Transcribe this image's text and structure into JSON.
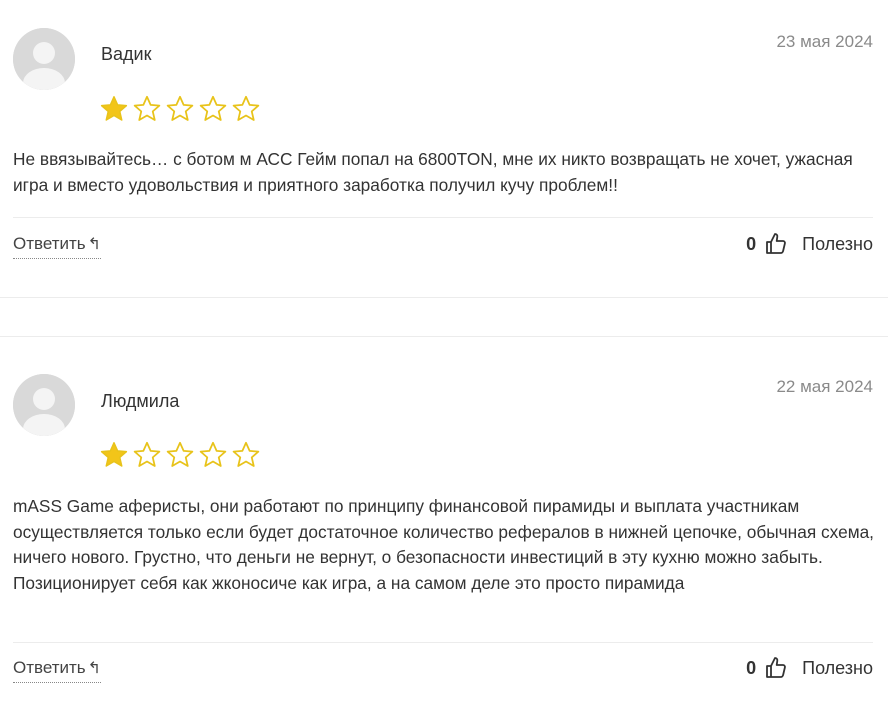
{
  "reviews": [
    {
      "author": "Вадик",
      "date": "23 мая 2024",
      "rating": 1,
      "max_rating": 5,
      "text": "Не ввязывайтесь… с ботом м АСС Гейм попал на 6800TON, мне их никто возвращать не хочет, ужасная игра и вместо удовольствия и приятного заработка получил кучу проблем!!",
      "reply_label": "Ответить",
      "helpful_count": "0",
      "helpful_label": "Полезно"
    },
    {
      "author": "Людмила",
      "date": "22 мая 2024",
      "rating": 1,
      "max_rating": 5,
      "text": "mASS Game аферисты, они работают по принципу финансовой пирамиды и выплата участникам осуществляется только если будет достаточное количество рефералов в нижней цепочке, обычная схема, ничего нового. Грустно, что деньги не вернут, о безопасности инвестиций в эту кухню можно забыть. Позиционирует себя как жконосиче как игра, а на самом деле это просто пирамида",
      "reply_label": "Ответить",
      "helpful_count": "0",
      "helpful_label": "Полезно"
    }
  ],
  "colors": {
    "star_filled": "#f2c519",
    "star_empty_stroke": "#e8c31a",
    "avatar_bg": "#d9d9d9",
    "divider": "#ececec"
  },
  "icons": {
    "reply": "reply-arrow-icon",
    "helpful": "thumbs-up-icon",
    "avatar": "user-placeholder-icon"
  }
}
